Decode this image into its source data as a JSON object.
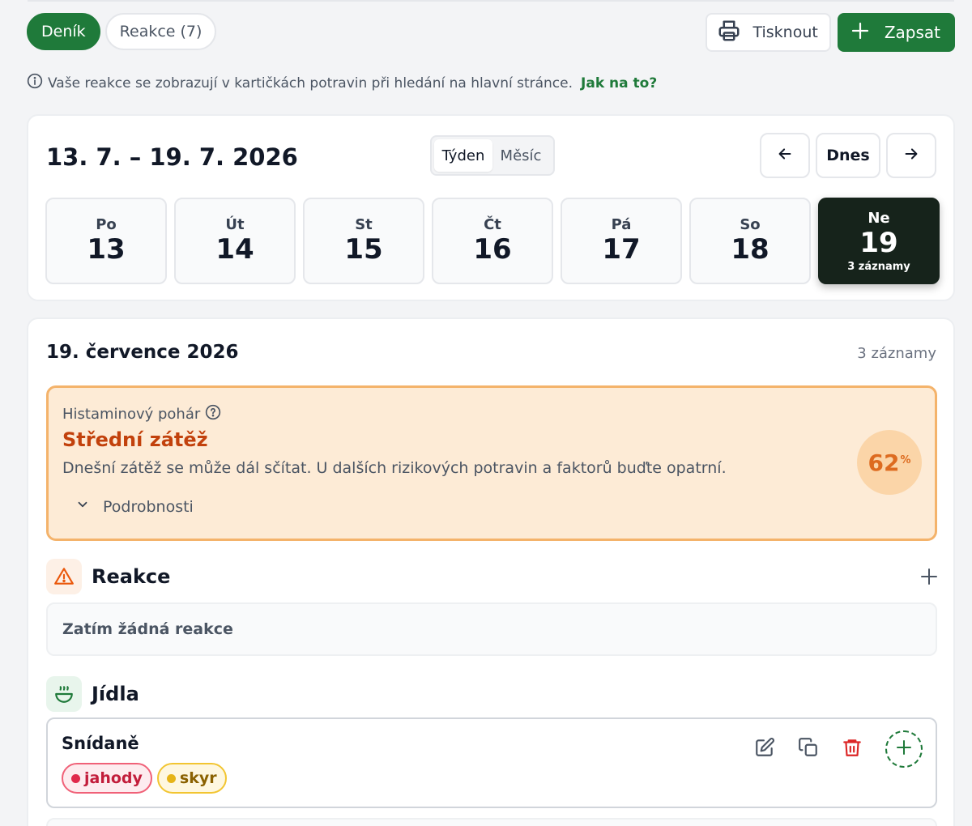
{
  "tabs": {
    "diary": "Deník",
    "reactions": "Reakce (7)"
  },
  "actions": {
    "print": "Tisknout",
    "add": "Zapsat"
  },
  "info": {
    "text": "Vaše reakce se zobrazují v kartičkách potravin při hledání na hlavní stránce.",
    "link": "Jak na to?"
  },
  "week": {
    "title": "13. 7. – 19. 7. 2026",
    "view_week": "Týden",
    "view_month": "Měsíc",
    "today": "Dnes",
    "days": [
      {
        "name": "Po",
        "date": "13"
      },
      {
        "name": "Út",
        "date": "14"
      },
      {
        "name": "St",
        "date": "15"
      },
      {
        "name": "Čt",
        "date": "16"
      },
      {
        "name": "Pá",
        "date": "17"
      },
      {
        "name": "So",
        "date": "18"
      },
      {
        "name": "Ne",
        "date": "19",
        "count": "3 záznamy"
      }
    ]
  },
  "day": {
    "title": "19. července 2026",
    "count": "3 záznamy",
    "histamine": {
      "label": "Histaminový pohár",
      "level": "Střední zátěž",
      "description": "Dnešní zátěž se může dál sčítat. U dalších rizikových potravin a faktorů buďte opatrní.",
      "details": "Podrobnosti",
      "percent": "62",
      "percent_sign": "%"
    },
    "reactions": {
      "title": "Reakce",
      "empty": "Zatím žádná reakce"
    },
    "meals": {
      "title": "Jídla",
      "items": [
        {
          "title": "Snídaně",
          "tags": [
            {
              "label": "jahody",
              "color": "#e0294b"
            },
            {
              "label": "skyr",
              "color": "#e6b417"
            }
          ]
        }
      ]
    }
  },
  "colors": {
    "brand": "#1f7a3a",
    "warning": "#c2410c",
    "selected_day": "#16231b"
  }
}
